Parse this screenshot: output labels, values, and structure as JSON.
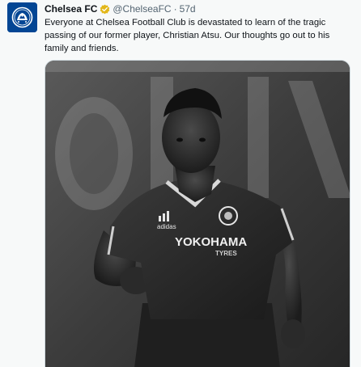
{
  "tweet": {
    "author_name": "Chelsea FC",
    "verified_icon": "gold-verified-badge-icon",
    "handle": "@ChelseaFC",
    "separator": "·",
    "time": "57d",
    "text": "Everyone at Chelsea Football Club is devastated to learn of the tragic passing of our former player, Christian Atsu. Our thoughts go out to his family and friends.",
    "avatar_icon": "chelsea-crest-icon"
  },
  "photo": {
    "description_icon": "player-photo",
    "shirt_sponsor": "YOKOHAMA",
    "shirt_sponsor_sub": "TYRES",
    "brand_mark": "adidas"
  },
  "colors": {
    "brand_blue": "#034694",
    "verified_gold": "#e2b719",
    "text_secondary": "#536471"
  }
}
